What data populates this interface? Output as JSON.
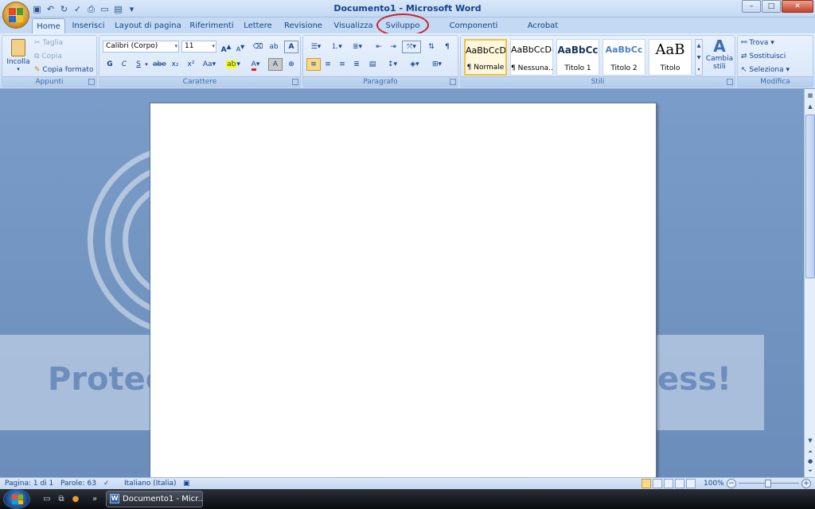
{
  "window": {
    "title": "Documento1 - Microsoft Word",
    "controls": {
      "minimize": "–",
      "maximize": "□",
      "close": "✕"
    }
  },
  "quick_access": [
    "save-icon",
    "undo-icon",
    "redo-icon",
    "spellcheck-icon",
    "print-preview-icon",
    "new-icon",
    "open-icon"
  ],
  "tabs": [
    {
      "label": "Home",
      "active": true
    },
    {
      "label": "Inserisci"
    },
    {
      "label": "Layout di pagina"
    },
    {
      "label": "Riferimenti"
    },
    {
      "label": "Lettere"
    },
    {
      "label": "Revisione"
    },
    {
      "label": "Visualizza"
    },
    {
      "label": "Sviluppo",
      "highlighted": true
    },
    {
      "label": "Componenti aggiuntivi"
    },
    {
      "label": "Acrobat"
    }
  ],
  "ribbon": {
    "clipboard": {
      "label": "Appunti",
      "paste": "Incolla",
      "cut": "Taglia",
      "copy": "Copia",
      "format_painter": "Copia formato"
    },
    "font": {
      "label": "Carattere",
      "font_name": "Calibri (Corpo)",
      "font_size": "11",
      "bold": "G",
      "italic": "C",
      "underline": "S",
      "strikethrough": "abe",
      "subscript": "x₂",
      "superscript": "x²",
      "case": "Aa",
      "grow": "A",
      "shrink": "A"
    },
    "paragraph": {
      "label": "Paragrafo"
    },
    "styles": {
      "label": "Stili",
      "items": [
        {
          "sample": "AaBbCcDc",
          "name": "¶ Normale",
          "selected": true
        },
        {
          "sample": "AaBbCcDc",
          "name": "¶ Nessuna..."
        },
        {
          "sample": "AaBbCc",
          "name": "Titolo 1"
        },
        {
          "sample": "AaBbCc",
          "name": "Titolo 2"
        },
        {
          "sample": "AaB",
          "name": "Titolo"
        }
      ],
      "change_styles": "Cambia stili"
    },
    "editing": {
      "label": "Modifica",
      "find": "Trova",
      "replace": "Sostituisci",
      "select": "Seleziona"
    }
  },
  "background": {
    "text_left": "Protec",
    "text_right": "ess!"
  },
  "status": {
    "page": "Pagina: 1 di 1",
    "words": "Parole: 63",
    "language": "Italiano (Italia)",
    "zoom": "100%"
  },
  "taskbar": {
    "task_label": "Documento1 - Micr..."
  }
}
